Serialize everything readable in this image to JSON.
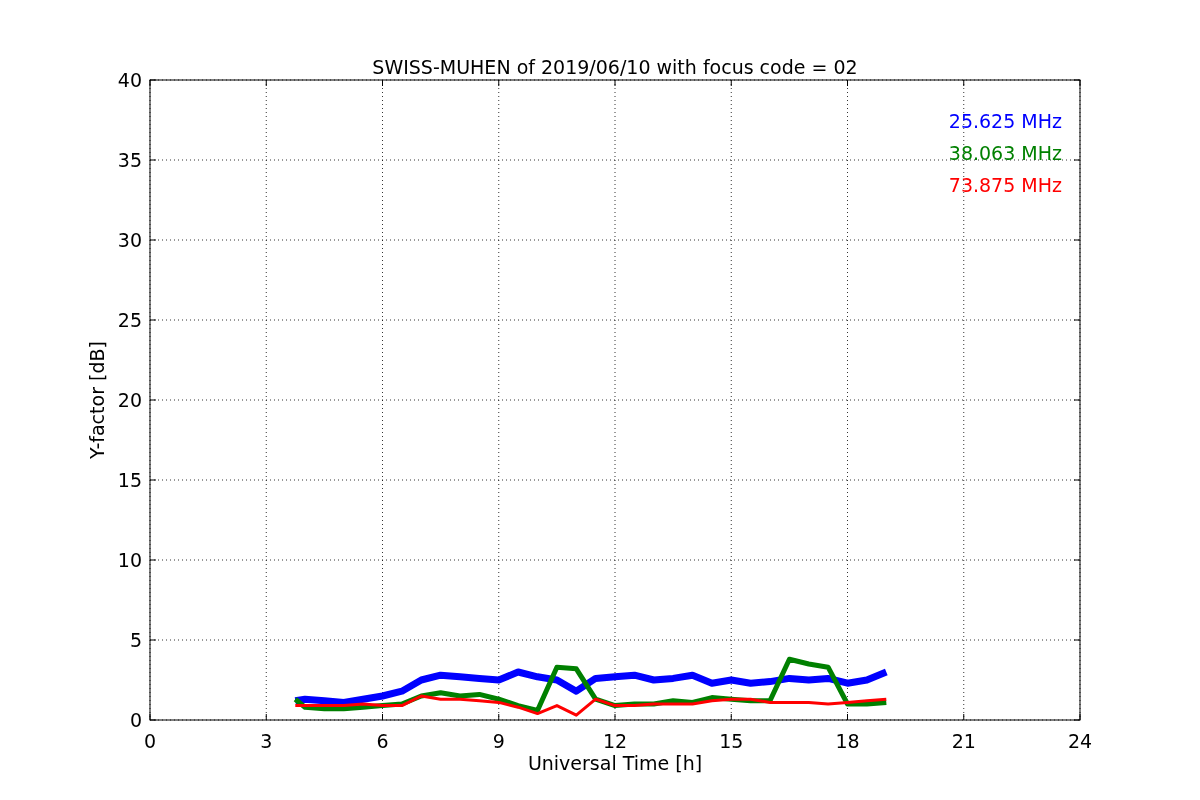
{
  "chart_data": {
    "type": "line",
    "title": "SWISS-MUHEN of 2019/06/10 with focus code = 02",
    "xlabel": "Universal Time [h]",
    "ylabel": "Y-factor [dB]",
    "x": [
      3.75,
      4,
      4.5,
      5,
      5.5,
      6,
      6.5,
      7,
      7.5,
      8,
      8.5,
      9,
      9.5,
      10,
      10.5,
      11,
      11.5,
      12,
      12.5,
      13,
      13.5,
      14,
      14.5,
      15,
      15.5,
      16,
      16.5,
      17,
      17.5,
      18,
      18.5,
      19
    ],
    "series": [
      {
        "name": "25.625 MHz",
        "color": "#0000ff",
        "values": [
          1.2,
          1.3,
          1.2,
          1.1,
          1.3,
          1.5,
          1.8,
          2.5,
          2.8,
          2.7,
          2.6,
          2.5,
          3.0,
          2.7,
          2.5,
          1.8,
          2.6,
          2.7,
          2.8,
          2.5,
          2.6,
          2.8,
          2.3,
          2.5,
          2.3,
          2.4,
          2.6,
          2.5,
          2.6,
          2.3,
          2.5,
          3.0
        ]
      },
      {
        "name": "38.063 MHz",
        "color": "#008000",
        "values": [
          1.3,
          0.8,
          0.7,
          0.7,
          0.8,
          0.9,
          1.0,
          1.5,
          1.7,
          1.5,
          1.6,
          1.3,
          0.9,
          0.6,
          3.3,
          3.2,
          1.3,
          0.9,
          1.0,
          1.0,
          1.2,
          1.1,
          1.4,
          1.3,
          1.2,
          1.2,
          3.8,
          3.5,
          3.3,
          1.0,
          1.0,
          1.1
        ]
      },
      {
        "name": "73.875 MHz",
        "color": "#ff0000",
        "values": [
          0.9,
          0.9,
          0.9,
          0.9,
          1.0,
          0.9,
          0.9,
          1.5,
          1.3,
          1.3,
          1.2,
          1.1,
          0.8,
          0.4,
          0.9,
          0.3,
          1.3,
          0.9,
          0.9,
          1.0,
          1.0,
          1.0,
          1.2,
          1.3,
          1.3,
          1.1,
          1.1,
          1.1,
          1.0,
          1.1,
          1.2,
          1.3
        ]
      }
    ],
    "xlim": [
      0,
      24
    ],
    "ylim": [
      0,
      40
    ],
    "xticks": [
      0,
      3,
      6,
      9,
      12,
      15,
      18,
      21,
      24
    ],
    "yticks": [
      0,
      5,
      10,
      15,
      20,
      25,
      30,
      35,
      40
    ],
    "grid": true
  }
}
